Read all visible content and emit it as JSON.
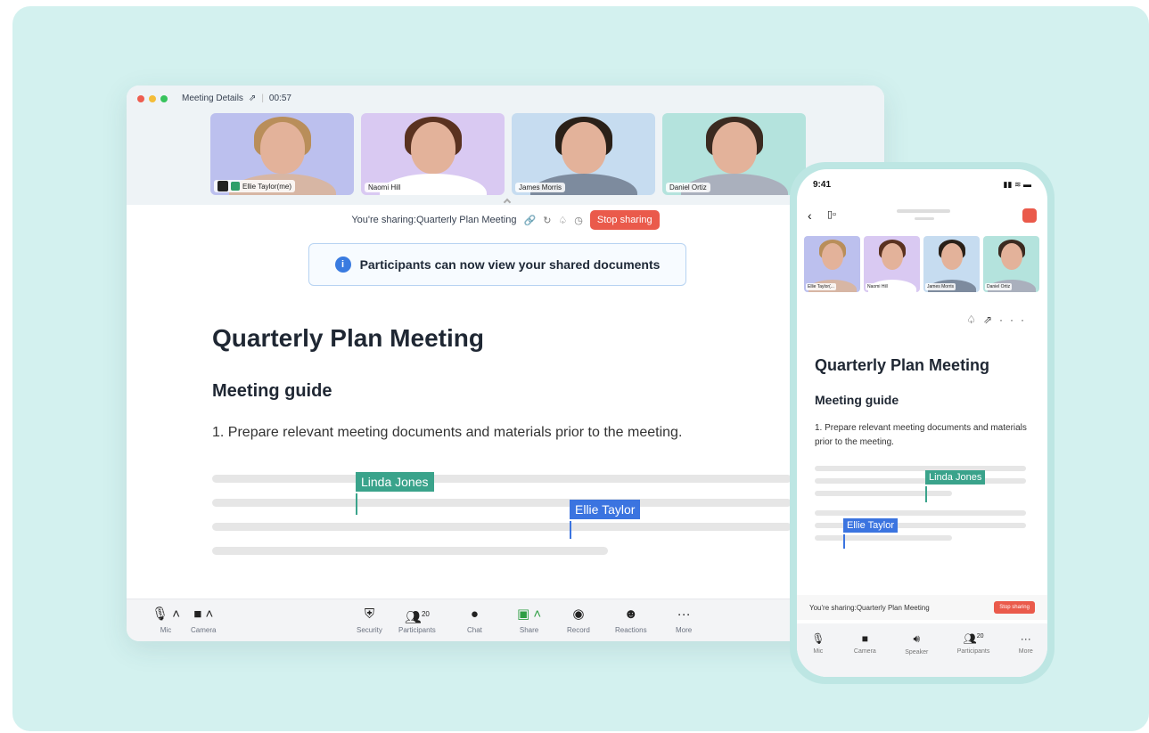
{
  "window": {
    "title": "Meeting Details",
    "timer": "00:57",
    "share_text": "You're sharing:Quarterly Plan Meeting",
    "stop_label": "Stop sharing",
    "toast": "Participants can now view your shared documents"
  },
  "participants": [
    {
      "name": "Ellie Taylor(me)",
      "hair": "#b98e5a",
      "shirt": "#d7b6a4",
      "bg": "#bcc0ee"
    },
    {
      "name": "Naomi Hill",
      "hair": "#5a3220",
      "shirt": "#ffffff",
      "bg": "#d9c9f2"
    },
    {
      "name": "James Morris",
      "hair": "#2a2018",
      "shirt": "#7d8b9e",
      "bg": "#c6dcf0"
    },
    {
      "name": "Daniel Ortiz",
      "hair": "#3b2a20",
      "shirt": "#aab0bd",
      "bg": "#b4e3dd"
    }
  ],
  "doc": {
    "title": "Quarterly Plan Meeting",
    "subtitle": "Meeting guide",
    "item": "1. Prepare relevant meeting documents and materials prior to the meeting.",
    "cursor1": "Linda Jones",
    "cursor2": "Ellie Taylor"
  },
  "toolbar": {
    "mic": "Mic",
    "camera": "Camera",
    "security": "Security",
    "participants": "Participants",
    "participants_count": "20",
    "chat": "Chat",
    "share": "Share",
    "record": "Record",
    "reactions": "Reactions",
    "more": "More"
  },
  "phone": {
    "time": "9:41",
    "tile_names": [
      "Ellie Taylor(...",
      "Naomi Hill",
      "James Morris",
      "Daniel Ortiz"
    ],
    "doc_title": "Quarterly Plan Meeting",
    "doc_subtitle": "Meeting guide",
    "doc_item": "1. Prepare relevant meeting documents and materials prior to the meeting.",
    "cursor1": "Linda Jones",
    "cursor2": "Ellie Taylor",
    "share_text": "You're sharing:Quarterly Plan Meeting",
    "stop_label": "Stop sharing",
    "tb": {
      "mic": "Mic",
      "camera": "Camera",
      "speaker": "Speaker",
      "participants": "Participants",
      "participants_count": "20",
      "more": "More"
    }
  },
  "colors": {
    "linda": "#3aa38b",
    "ellie": "#3b74e0",
    "stop": "#ea5a4b"
  }
}
